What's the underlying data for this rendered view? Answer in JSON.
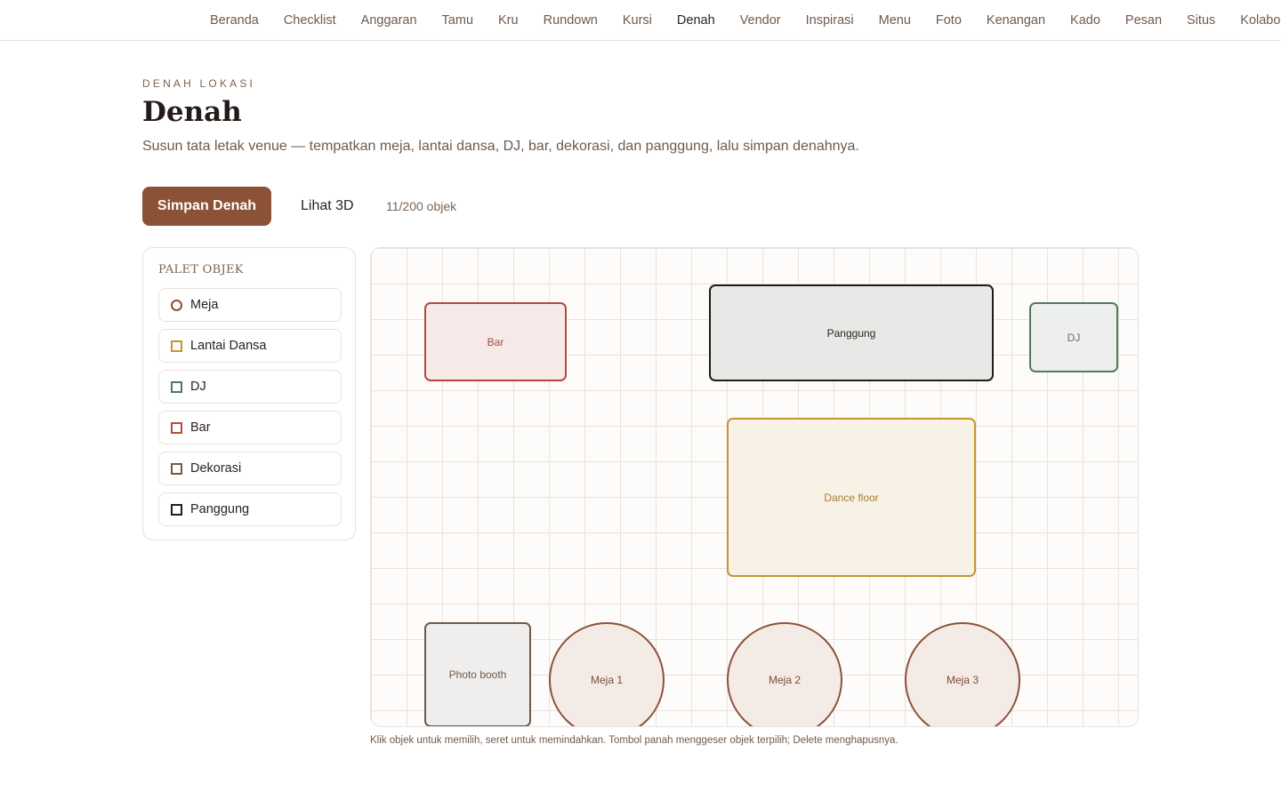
{
  "nav": {
    "tabs": [
      "Beranda",
      "Checklist",
      "Anggaran",
      "Tamu",
      "Kru",
      "Rundown",
      "Kursi",
      "Denah",
      "Vendor",
      "Inspirasi",
      "Menu",
      "Foto",
      "Kenangan",
      "Kado",
      "Pesan",
      "Situs",
      "Kolaborasi"
    ],
    "active": "Denah"
  },
  "header": {
    "eyebrow": "DENAH LOKASI",
    "title": "Denah",
    "subtitle": "Susun tata letak venue — tempatkan meja, lantai dansa, DJ, bar, dekorasi, dan panggung, lalu simpan denahnya."
  },
  "toolbar": {
    "save_label": "Simpan Denah",
    "view3d_label": "Lihat 3D",
    "count_text": "11/200 objek"
  },
  "palette": {
    "title": "PALET OBJEK",
    "items": [
      {
        "label": "Meja",
        "shape": "circle",
        "color": "#8b5238"
      },
      {
        "label": "Lantai Dansa",
        "shape": "square",
        "color": "#c4962e"
      },
      {
        "label": "DJ",
        "shape": "square",
        "color": "#4f7a5c"
      },
      {
        "label": "Bar",
        "shape": "square",
        "color": "#b24a3c"
      },
      {
        "label": "Dekorasi",
        "shape": "square",
        "color": "#6e5a4c"
      },
      {
        "label": "Panggung",
        "shape": "square",
        "color": "#231b18"
      }
    ]
  },
  "floorplan": {
    "objects": [
      {
        "label": "Bar",
        "kind": "bar",
        "color": "#b24a3c",
        "fill": "#f6e9e7",
        "text_color": "#9a5040"
      },
      {
        "label": "Panggung",
        "kind": "stage",
        "color": "#231b18",
        "fill": "#e8e8e7",
        "text_color": "#2b2220"
      },
      {
        "label": "DJ",
        "kind": "dj",
        "color": "#4f7a5c",
        "fill": "#ecefec",
        "text_color": "#6e6e6e"
      },
      {
        "label": "Dance floor",
        "kind": "dancefloor",
        "color": "#c4962e",
        "fill": "#f8f1e6",
        "text_color": "#a6812f"
      },
      {
        "label": "Photo booth",
        "kind": "decor",
        "color": "#6e5a4c",
        "fill": "#efeeed",
        "text_color": "#6e5a4c"
      },
      {
        "label": "Meja 1",
        "kind": "table",
        "color": "#8b5238",
        "fill": "#f4ebe7",
        "text_color": "#7a4a36"
      },
      {
        "label": "Meja 2",
        "kind": "table",
        "color": "#8b5238",
        "fill": "#f4ebe7",
        "text_color": "#7a4a36"
      },
      {
        "label": "Meja 3",
        "kind": "table",
        "color": "#8b5238",
        "fill": "#f4ebe7",
        "text_color": "#7a4a36"
      }
    ]
  },
  "hint": "Klik objek untuk memilih, seret untuk memindahkan. Tombol panah menggeser objek terpilih; Delete menghapusnya."
}
